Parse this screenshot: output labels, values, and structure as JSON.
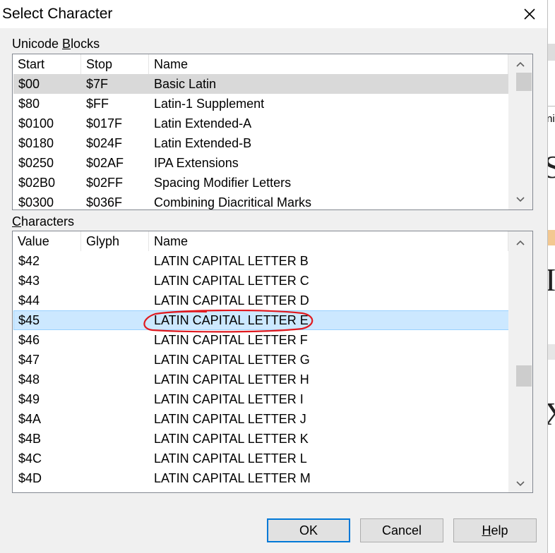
{
  "window": {
    "title": "Select Character"
  },
  "unicode_blocks": {
    "label_pre": "Unicode ",
    "label_accel": "B",
    "label_post": "locks",
    "columns": [
      "Start",
      "Stop",
      "Name"
    ],
    "rows": [
      {
        "start": "$00",
        "stop": "$7F",
        "name": "Basic Latin",
        "selected": true
      },
      {
        "start": "$80",
        "stop": "$FF",
        "name": "Latin-1 Supplement"
      },
      {
        "start": "$0100",
        "stop": "$017F",
        "name": "Latin Extended-A"
      },
      {
        "start": "$0180",
        "stop": "$024F",
        "name": "Latin Extended-B"
      },
      {
        "start": "$0250",
        "stop": "$02AF",
        "name": "IPA Extensions"
      },
      {
        "start": "$02B0",
        "stop": "$02FF",
        "name": "Spacing Modifier Letters"
      },
      {
        "start": "$0300",
        "stop": "$036F",
        "name": "Combining Diacritical Marks"
      }
    ]
  },
  "characters": {
    "label_accel": "C",
    "label_post": "haracters",
    "columns": [
      "Value",
      "Glyph",
      "Name"
    ],
    "rows": [
      {
        "value": "$42",
        "glyph": "",
        "name": "LATIN CAPITAL LETTER B"
      },
      {
        "value": "$43",
        "glyph": "",
        "name": "LATIN CAPITAL LETTER C"
      },
      {
        "value": "$44",
        "glyph": "",
        "name": "LATIN CAPITAL LETTER D"
      },
      {
        "value": "$45",
        "glyph": "",
        "name": "LATIN CAPITAL LETTER E",
        "selected": true
      },
      {
        "value": "$46",
        "glyph": "",
        "name": "LATIN CAPITAL LETTER F"
      },
      {
        "value": "$47",
        "glyph": "",
        "name": "LATIN CAPITAL LETTER G"
      },
      {
        "value": "$48",
        "glyph": "",
        "name": "LATIN CAPITAL LETTER H"
      },
      {
        "value": "$49",
        "glyph": "",
        "name": "LATIN CAPITAL LETTER I"
      },
      {
        "value": "$4A",
        "glyph": "",
        "name": "LATIN CAPITAL LETTER J"
      },
      {
        "value": "$4B",
        "glyph": "",
        "name": "LATIN CAPITAL LETTER K"
      },
      {
        "value": "$4C",
        "glyph": "",
        "name": "LATIN CAPITAL LETTER L"
      },
      {
        "value": "$4D",
        "glyph": "",
        "name": "LATIN CAPITAL LETTER M"
      }
    ]
  },
  "buttons": {
    "ok": "OK",
    "cancel": "Cancel",
    "help_accel": "H",
    "help_post": "elp"
  },
  "background_app": {
    "glyphs": [
      "S",
      "I",
      "X"
    ],
    "fragment": "ni"
  },
  "icons": {
    "close": "close-icon",
    "scroll_up": "chevron-up-icon",
    "scroll_down": "chevron-down-icon"
  },
  "colors": {
    "selection_blue": "#cce8ff",
    "selection_grey": "#d9d9d9",
    "default_button_border": "#0078d7",
    "annotation_red": "#e0191e"
  }
}
